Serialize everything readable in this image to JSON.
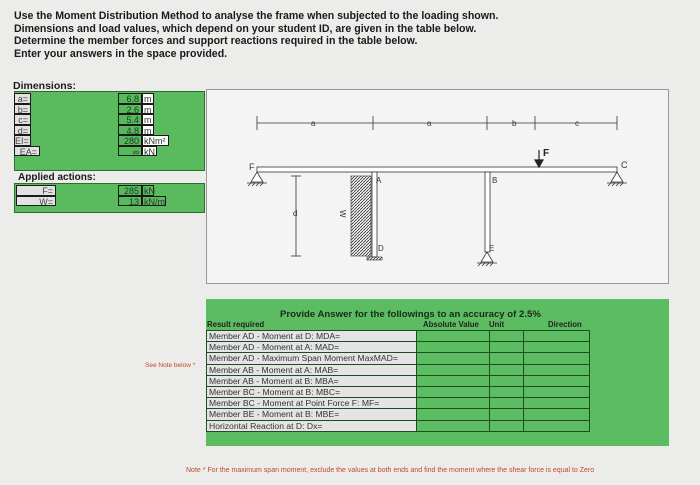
{
  "instructions": [
    "Use the Moment Distribution Method to analyse the frame when subjected to the loading shown.",
    "Dimensions and load values, which depend on your student ID, are given in the table below.",
    "Determine the member forces and support reactions required in the table below.",
    "Enter your answers in the space provided."
  ],
  "dimensions": {
    "title": "Dimensions:",
    "rows": [
      {
        "label": "a=",
        "value": "6.8",
        "unit": "m"
      },
      {
        "label": "b=",
        "value": "2.6",
        "unit": "m"
      },
      {
        "label": "c=",
        "value": "5.4",
        "unit": "m"
      },
      {
        "label": "d=",
        "value": "4.8",
        "unit": "m"
      },
      {
        "label": "EI=",
        "value": "280",
        "unit": "kNm²"
      },
      {
        "label": "EA=",
        "value": "∞",
        "unit": "kN"
      }
    ]
  },
  "applied": {
    "title": "Applied actions:",
    "rows": [
      {
        "label": "F=",
        "value": "285",
        "unit": "kN"
      },
      {
        "label": "W=",
        "value": "13",
        "unit": "kN/m"
      }
    ]
  },
  "diagram": {
    "dim_a1": "a",
    "dim_a2": "a",
    "dim_b": "b",
    "dim_c": "c",
    "dim_d": "d",
    "node_a": "A",
    "node_b": "B",
    "node_c": "C",
    "node_d": "D",
    "node_e": "E",
    "node_f": "F",
    "force_label": "F",
    "load_label": "W"
  },
  "answers": {
    "prompt": "Provide Answer for the followings to an accuracy of 2.5%",
    "header_result": "Result required",
    "header_abs": "Absolute Value",
    "header_unit": "Unit",
    "header_dir": "Direction",
    "see_note": "See Note below *",
    "rows": [
      "Member AD - Moment at D: MDA=",
      "Member AD - Moment at A: MAD=",
      "Member AD - Maximum Span Moment MaxMAD=",
      "Member AB - Moment at A: MAB=",
      "Member AB - Moment at B: MBA=",
      "Member BC - Moment at B: MBC=",
      "Member BC - Moment at Point Force F: MF=",
      "Member BE - Moment at B: MBE=",
      "Horizontal Reaction at D: Dx="
    ],
    "note": "Note * For the maximum span moment, exclude the values at both ends and find the moment where the shear force is equal to Zero"
  }
}
